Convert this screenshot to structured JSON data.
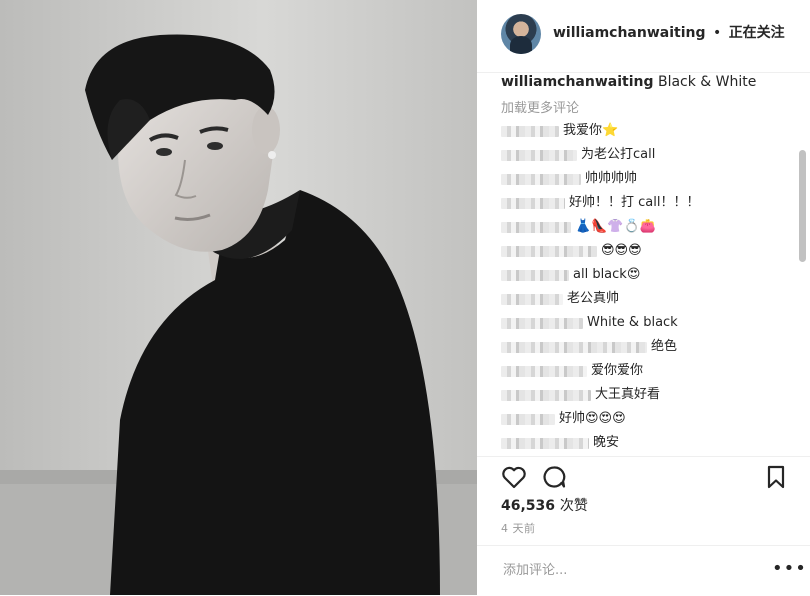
{
  "post_header": {
    "username": "williamchanwaiting",
    "separator": "•",
    "follow_status": "正在关注"
  },
  "caption": {
    "username": "williamchanwaiting",
    "text": "Black & White"
  },
  "load_more_comments": "加载更多评论",
  "comments": [
    {
      "text": "我爱你⭐"
    },
    {
      "text": "为老公打call"
    },
    {
      "text": "帅帅帅帅"
    },
    {
      "text": "好帅！！打 call！！！"
    },
    {
      "text": "👗👠👚💍👛"
    },
    {
      "text": "😎😎😎"
    },
    {
      "text": "all black😍"
    },
    {
      "text": "老公真帅"
    },
    {
      "text": "White & black"
    },
    {
      "text": "绝色"
    },
    {
      "text": "爱你爱你"
    },
    {
      "text": "大王真好看"
    },
    {
      "text": "好帅😍😍😍"
    },
    {
      "text": "晚安"
    }
  ],
  "likes": {
    "count": "46,536",
    "label": "次赞"
  },
  "time_ago": "4 天前",
  "add_comment": {
    "placeholder": "添加评论..."
  },
  "more_options": "•••",
  "icons": {
    "like": "heart-icon",
    "comment": "comment-icon",
    "save": "bookmark-icon",
    "more": "more-icon"
  },
  "colors": {
    "text": "#262626",
    "muted": "#999999",
    "divider": "#efefef"
  }
}
